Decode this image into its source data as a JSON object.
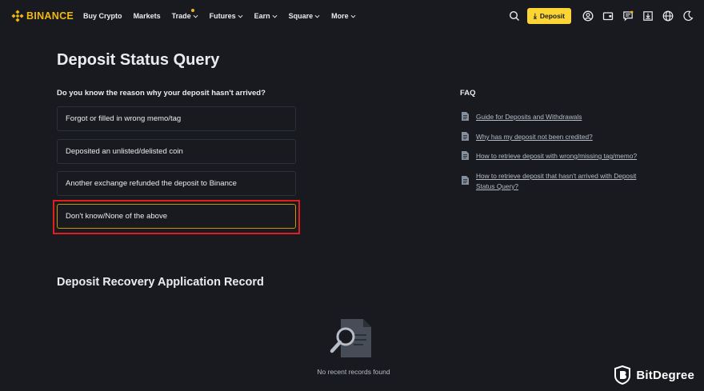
{
  "nav": {
    "logo_text": "BINANCE",
    "items": [
      {
        "label": "Buy Crypto",
        "dropdown": false,
        "dot": false
      },
      {
        "label": "Markets",
        "dropdown": false,
        "dot": false
      },
      {
        "label": "Trade",
        "dropdown": true,
        "dot": true
      },
      {
        "label": "Futures",
        "dropdown": true,
        "dot": false
      },
      {
        "label": "Earn",
        "dropdown": true,
        "dot": false
      },
      {
        "label": "Square",
        "dropdown": true,
        "dot": false
      },
      {
        "label": "More",
        "dropdown": true,
        "dot": false
      }
    ],
    "deposit_label": "Deposit",
    "right_icons": [
      "search-icon",
      "user-icon",
      "wallet-icon",
      "message-icon",
      "download-icon",
      "globe-icon",
      "moon-icon"
    ]
  },
  "main": {
    "title": "Deposit Status Query",
    "question": "Do you know the reason why your deposit hasn't arrived?",
    "options": [
      "Forgot or filled in wrong memo/tag",
      "Deposited an unlisted/delisted coin",
      "Another exchange refunded the deposit to Binance",
      "Don't know/None of the above"
    ],
    "selected_option_index": 3
  },
  "faq": {
    "title": "FAQ",
    "items": [
      "Guide for Deposits and Withdrawals",
      "Why has my deposit not been credited?",
      "How to retrieve deposit with wrong/missing tag/memo?",
      "How to retrieve deposit that hasn't arrived with Deposit Status Query?"
    ]
  },
  "records": {
    "title": "Deposit Recovery Application Record",
    "empty_text": "No recent records found"
  },
  "watermark": {
    "text": "BitDegree"
  },
  "colors": {
    "background": "#181a20",
    "accent": "#fcd535",
    "brand": "#f0b90b",
    "highlight": "#e0201f",
    "option_border": "#2b3139",
    "selected_border": "#c99400"
  }
}
